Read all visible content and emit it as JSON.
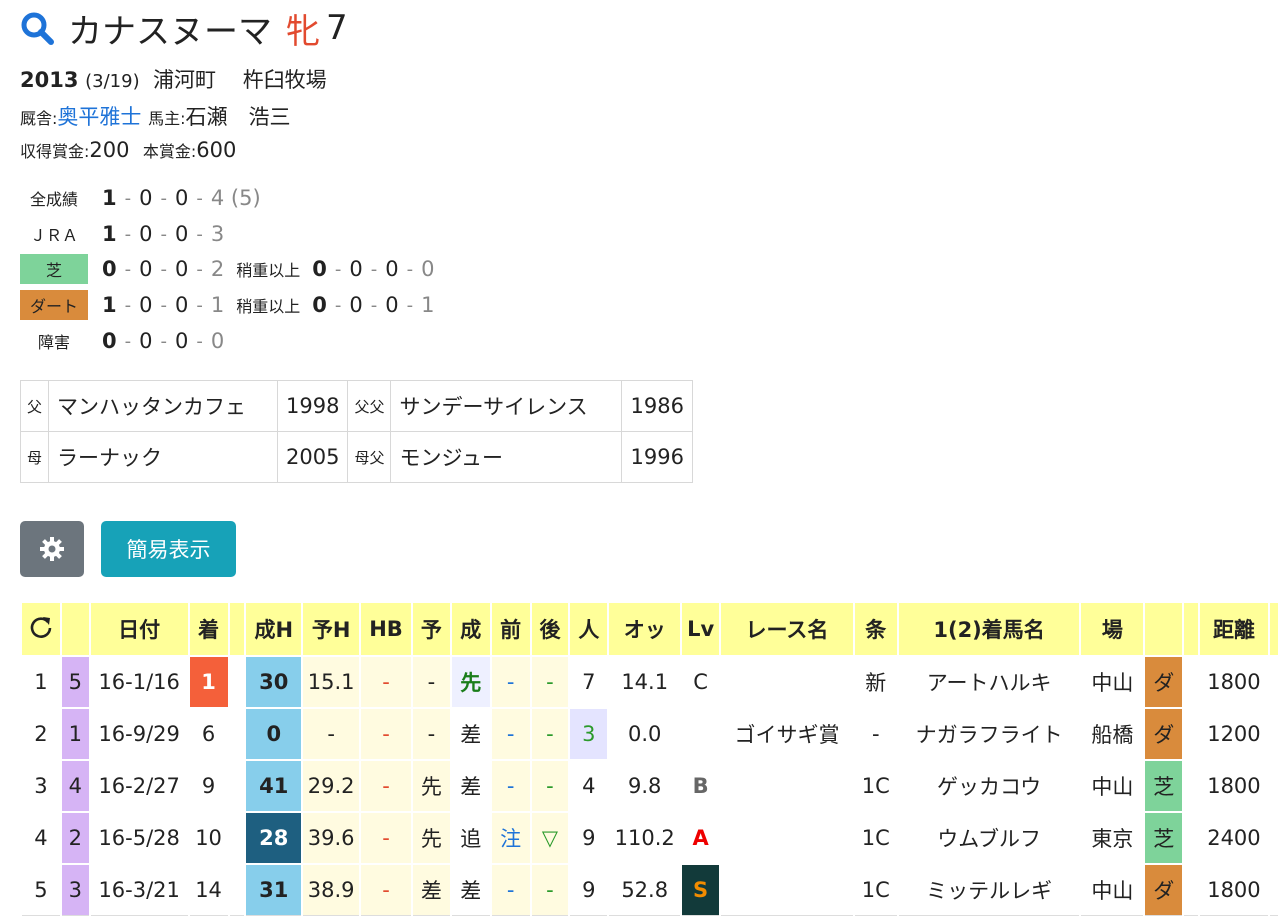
{
  "horse": {
    "name": "カナスヌーマ",
    "sex": "牝",
    "age": "7",
    "year": "2013",
    "birth_date": "(3/19)",
    "location": "浦河町",
    "farm": "杵臼牧場",
    "trainer_label": "厩舎:",
    "trainer": "奥平雅士",
    "owner_label": "馬主:",
    "owner": "石瀬　浩三",
    "earned_label": "収得賞金:",
    "earned": "200",
    "prize_label": "本賞金:",
    "prize": "600"
  },
  "records": [
    {
      "label": "全成績",
      "a": "1",
      "b": "0",
      "c": "0",
      "d": "4 (5)"
    },
    {
      "label": "ＪＲＡ",
      "a": "1",
      "b": "0",
      "c": "0",
      "d": "3"
    },
    {
      "label": "芝",
      "a": "0",
      "b": "0",
      "c": "0",
      "d": "2",
      "heavy_label": "稍重以上",
      "ha": "0",
      "hb": "0",
      "hc": "0",
      "hd": "0"
    },
    {
      "label": "ダート",
      "a": "1",
      "b": "0",
      "c": "0",
      "d": "1",
      "heavy_label": "稍重以上",
      "ha": "0",
      "hb": "0",
      "hc": "0",
      "hd": "1"
    },
    {
      "label": "障害",
      "a": "0",
      "b": "0",
      "c": "0",
      "d": "0"
    }
  ],
  "pedigree": {
    "sire_label": "父",
    "sire": "マンハッタンカフェ",
    "sire_year": "1998",
    "sire_sire_label": "父父",
    "sire_sire": "サンデーサイレンス",
    "sire_sire_year": "1986",
    "dam_label": "母",
    "dam": "ラーナック",
    "dam_year": "2005",
    "dam_sire_label": "母父",
    "dam_sire": "モンジュー",
    "dam_sire_year": "1996"
  },
  "buttons": {
    "simple": "簡易表示"
  },
  "table": {
    "headers": [
      "日付",
      "着",
      "成H",
      "予H",
      "HB",
      "予",
      "成",
      "前",
      "後",
      "人",
      "オッ",
      "Lv",
      "レース名",
      "条",
      "1(2)着馬名",
      "場",
      "",
      "距離"
    ],
    "rows": [
      {
        "no": "1",
        "frame": "5",
        "date": "16-1/16",
        "pos": "1",
        "sh": "30",
        "yh": "15.1",
        "hb": "-",
        "yo": "-",
        "sei": "先",
        "mae": "-",
        "ato": "-",
        "pop": "7",
        "odds": "14.1",
        "lv": "C",
        "race": "",
        "cond": "新",
        "horse": "アートハルキ",
        "track": "中山",
        "surf": "ダ",
        "dist": "1800"
      },
      {
        "no": "2",
        "frame": "1",
        "date": "16-9/29",
        "pos": "6",
        "sh": "0",
        "yh": "-",
        "hb": "-",
        "yo": "-",
        "sei": "差",
        "mae": "-",
        "ato": "-",
        "pop": "3",
        "odds": "0.0",
        "lv": "",
        "race": "ゴイサギ賞",
        "cond": "-",
        "horse": "ナガラフライト",
        "track": "船橋",
        "surf": "ダ",
        "dist": "1200"
      },
      {
        "no": "3",
        "frame": "4",
        "date": "16-2/27",
        "pos": "9",
        "sh": "41",
        "yh": "29.2",
        "hb": "-",
        "yo": "先",
        "sei": "差",
        "mae": "-",
        "ato": "-",
        "pop": "4",
        "odds": "9.8",
        "lv": "B",
        "race": "",
        "cond": "1C",
        "horse": "ゲッカコウ",
        "track": "中山",
        "surf": "芝",
        "dist": "1800"
      },
      {
        "no": "4",
        "frame": "2",
        "date": "16-5/28",
        "pos": "10",
        "sh": "28",
        "yh": "39.6",
        "hb": "-",
        "yo": "先",
        "sei": "追",
        "mae": "注",
        "ato": "▽",
        "pop": "9",
        "odds": "110.2",
        "lv": "A",
        "race": "",
        "cond": "1C",
        "horse": "ウムブルフ",
        "track": "東京",
        "surf": "芝",
        "dist": "2400"
      },
      {
        "no": "5",
        "frame": "3",
        "date": "16-3/21",
        "pos": "14",
        "sh": "31",
        "yh": "38.9",
        "hb": "-",
        "yo": "差",
        "sei": "差",
        "mae": "-",
        "ato": "-",
        "pop": "9",
        "odds": "52.8",
        "lv": "S",
        "race": "",
        "cond": "1C",
        "horse": "ミッテルレギ",
        "track": "中山",
        "surf": "ダ",
        "dist": "1800"
      }
    ]
  }
}
